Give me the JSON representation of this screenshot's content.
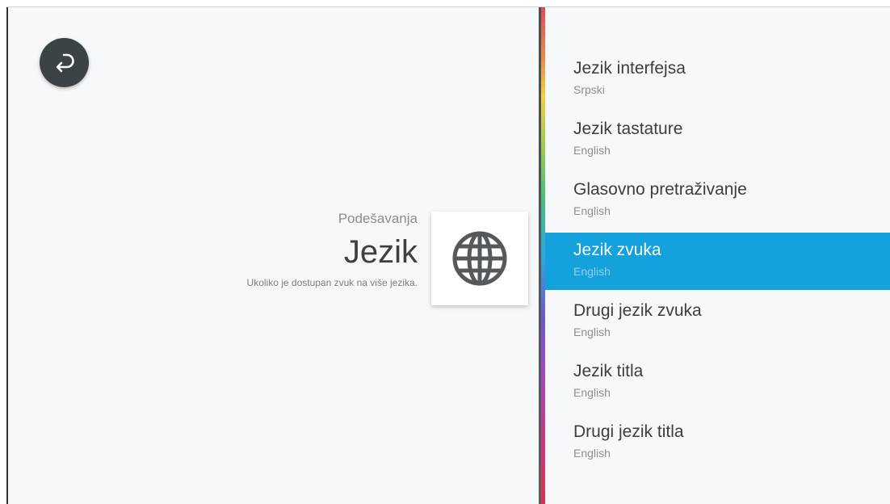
{
  "header": {
    "breadcrumb": "Podešavanja",
    "title": "Jezik",
    "description": "Ukoliko je dostupan zvuk na više jezika."
  },
  "icons": {
    "back": "back-arrow-icon",
    "category": "globe-icon"
  },
  "colors": {
    "selected_bg": "#14a1dc",
    "back_button": "#3b4347"
  },
  "menu": {
    "items": [
      {
        "label": "Jezik interfejsa",
        "value": "Srpski"
      },
      {
        "label": "Jezik tastature",
        "value": "English"
      },
      {
        "label": "Glasovno pretraživanje",
        "value": "English"
      },
      {
        "label": "Jezik zvuka",
        "value": "English",
        "selected": true
      },
      {
        "label": "Drugi jezik zvuka",
        "value": "English"
      },
      {
        "label": "Jezik titla",
        "value": "English"
      },
      {
        "label": "Drugi jezik titla",
        "value": "English"
      }
    ]
  }
}
